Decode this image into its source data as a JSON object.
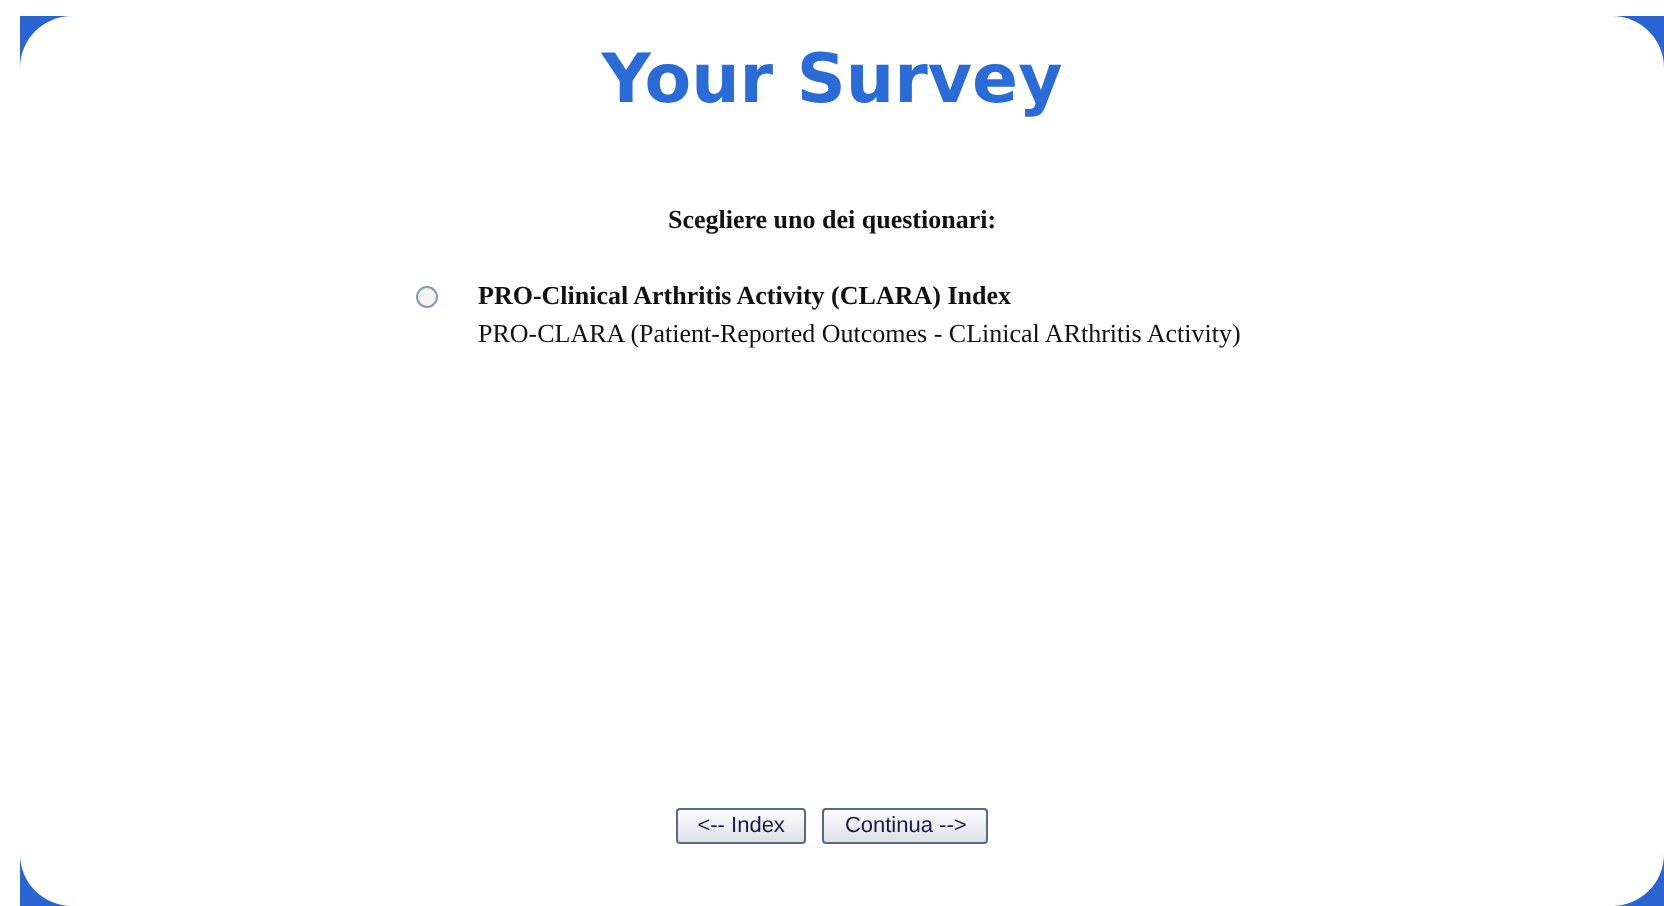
{
  "title": "Your Survey",
  "prompt": "Scegliere uno dei questionari:",
  "options": [
    {
      "title": "PRO-Clinical Arthritis Activity (CLARA) Index",
      "description": "PRO-CLARA (Patient-Reported Outcomes - CLinical ARthritis Activity)",
      "selected": false
    }
  ],
  "buttons": [
    "<-- Index",
    "Continua -->"
  ]
}
